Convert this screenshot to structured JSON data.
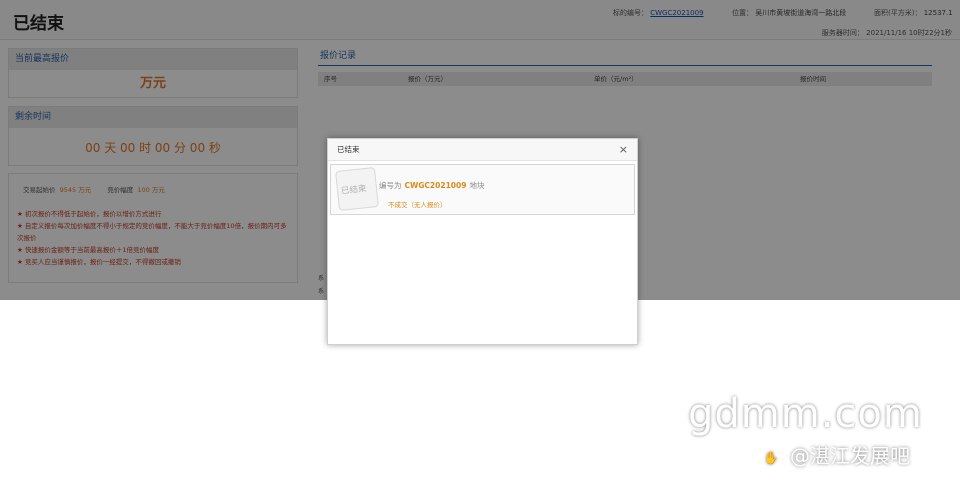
{
  "page": {
    "title": "已结束",
    "object_no_label": "标的编号：",
    "object_no": "CWGC2021009",
    "location_label": "位置：",
    "location": "吴川市黄坡街道海湾一路北段",
    "area_label": "面积(平方米)：",
    "area": "12537.1",
    "server_time_label": "服务器时间：",
    "server_time": "2021/11/16  10时22分1秒"
  },
  "highest_bid": {
    "header": "当前最高报价",
    "value": "万元"
  },
  "remaining": {
    "header": "剩余时间",
    "value": "00 天 00 时 00 分 00 秒"
  },
  "info": {
    "start_price_label": "交易起始价",
    "start_price": "9545 万元",
    "increment_label": "竞价幅度",
    "increment": "100 万元",
    "rules": [
      "★ 初次报价不得低于起始价，报价以增价方式进行",
      "★ 自定义报价每次加价幅度不得小于规定的竞价幅度，不能大于竞价幅度10倍，报价期内可多次报价",
      "★ 快速报价金额等于当前最高报价＋1倍竞价幅度",
      "★ 竞买人应当谨慎报价，报价一经提交，不得撤回或撤销"
    ]
  },
  "records": {
    "header": "报价记录",
    "columns": [
      "序号",
      "报价（万元）",
      "单价（元/m²）",
      "报价时间"
    ],
    "fragments": [
      "系",
      "系"
    ]
  },
  "modal": {
    "title": "已结束",
    "close_glyph": "×",
    "stamp_text": "已结束",
    "prefix": "编号为",
    "code": "CWGC2021009",
    "suffix": "地块",
    "status": "不成交（无人报价）"
  },
  "watermark": {
    "site": "gdmm.com",
    "forum": "@湛江发展吧",
    "icon": "paw-icon"
  }
}
